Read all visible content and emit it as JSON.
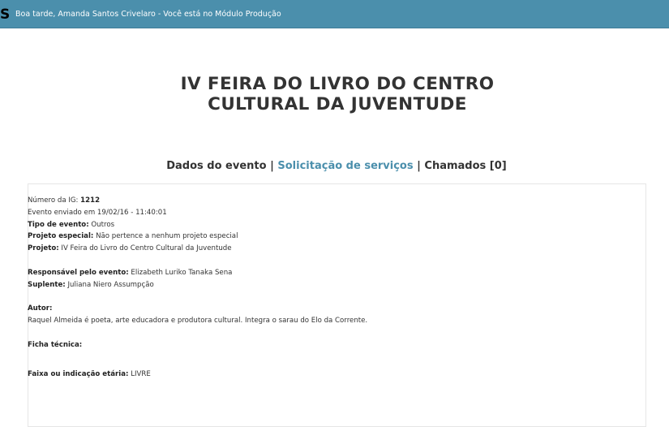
{
  "header": {
    "brand": "S",
    "greeting": "Boa tarde, Amanda Santos Crivelaro - Você está no Módulo Produção",
    "bar_color": "#4b8fac"
  },
  "event": {
    "title_line1": "IV FEIRA DO LIVRO DO CENTRO",
    "title_line2": "CULTURAL DA JUVENTUDE"
  },
  "tabs": {
    "dados": "Dados do evento",
    "separator": "|",
    "solicitacao": "Solicitação de serviços",
    "chamados": "Chamados [0]",
    "link_color": "#4b8fac"
  },
  "details": {
    "numero_label": "Número da IG:",
    "numero_value": "1212",
    "enviado": "Evento enviado em 19/02/16 - 11:40:01",
    "tipo_label": "Tipo de evento:",
    "tipo_value": "Outros",
    "projeto_especial_label": "Projeto especial:",
    "projeto_especial_value": "Não pertence a nenhum projeto especial",
    "projeto_label": "Projeto:",
    "projeto_value": "IV Feira do Livro do Centro Cultural da Juventude",
    "responsavel_label": "Responsável pelo evento:",
    "responsavel_value": "Elizabeth Luriko Tanaka Sena",
    "suplente_label": "Suplente:",
    "suplente_value": "Juliana Niero Assumpção",
    "autor_label": "Autor:",
    "autor_value": "Raquel Almeida é poeta, arte educadora e produtora cultural. Integra o sarau do Elo da Corrente.",
    "ficha_label": "Ficha técnica:",
    "faixa_label": "Faixa ou indicação etária:",
    "faixa_value": "LIVRE"
  }
}
